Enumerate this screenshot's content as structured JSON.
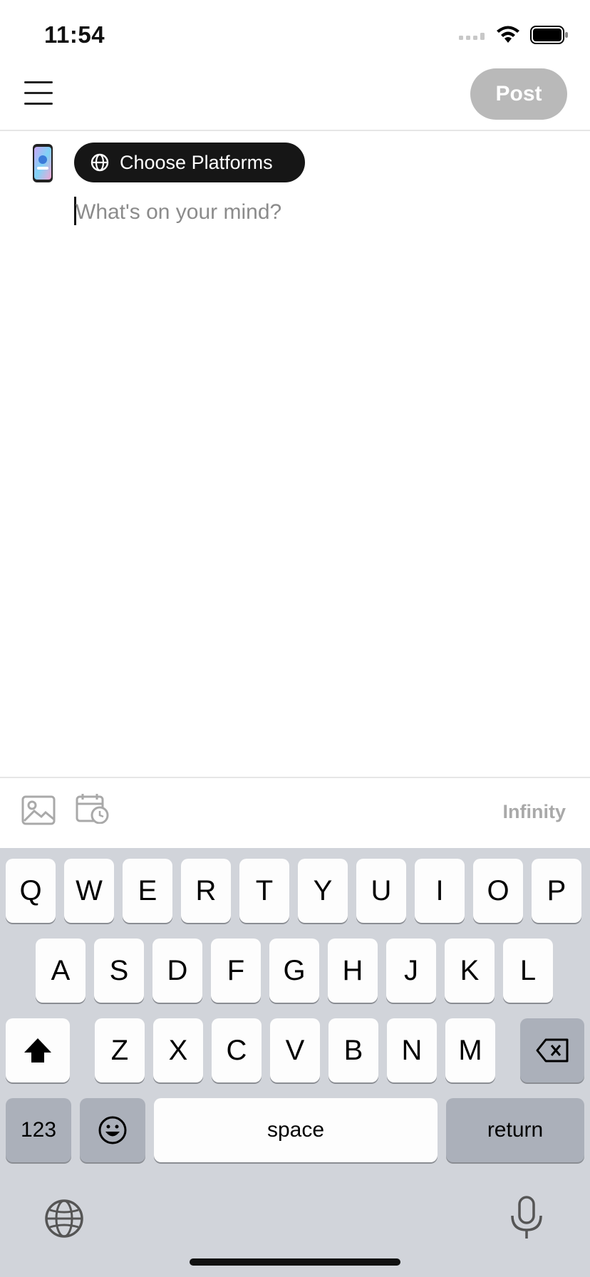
{
  "status_bar": {
    "time": "11:54"
  },
  "header": {
    "post_label": "Post"
  },
  "composer": {
    "platform_button_label": "Choose Platforms",
    "placeholder": "What's on your mind?"
  },
  "toolbar": {
    "limit_label": "Infinity"
  },
  "keyboard": {
    "row1": [
      "Q",
      "W",
      "E",
      "R",
      "T",
      "Y",
      "U",
      "I",
      "O",
      "P"
    ],
    "row2": [
      "A",
      "S",
      "D",
      "F",
      "G",
      "H",
      "J",
      "K",
      "L"
    ],
    "row3": [
      "Z",
      "X",
      "C",
      "V",
      "B",
      "N",
      "M"
    ],
    "numbers_label": "123",
    "space_label": "space",
    "return_label": "return"
  },
  "colors": {
    "post_disabled": "#b9b9b9",
    "chip_background": "#161616",
    "keyboard_background": "#d1d4da"
  }
}
